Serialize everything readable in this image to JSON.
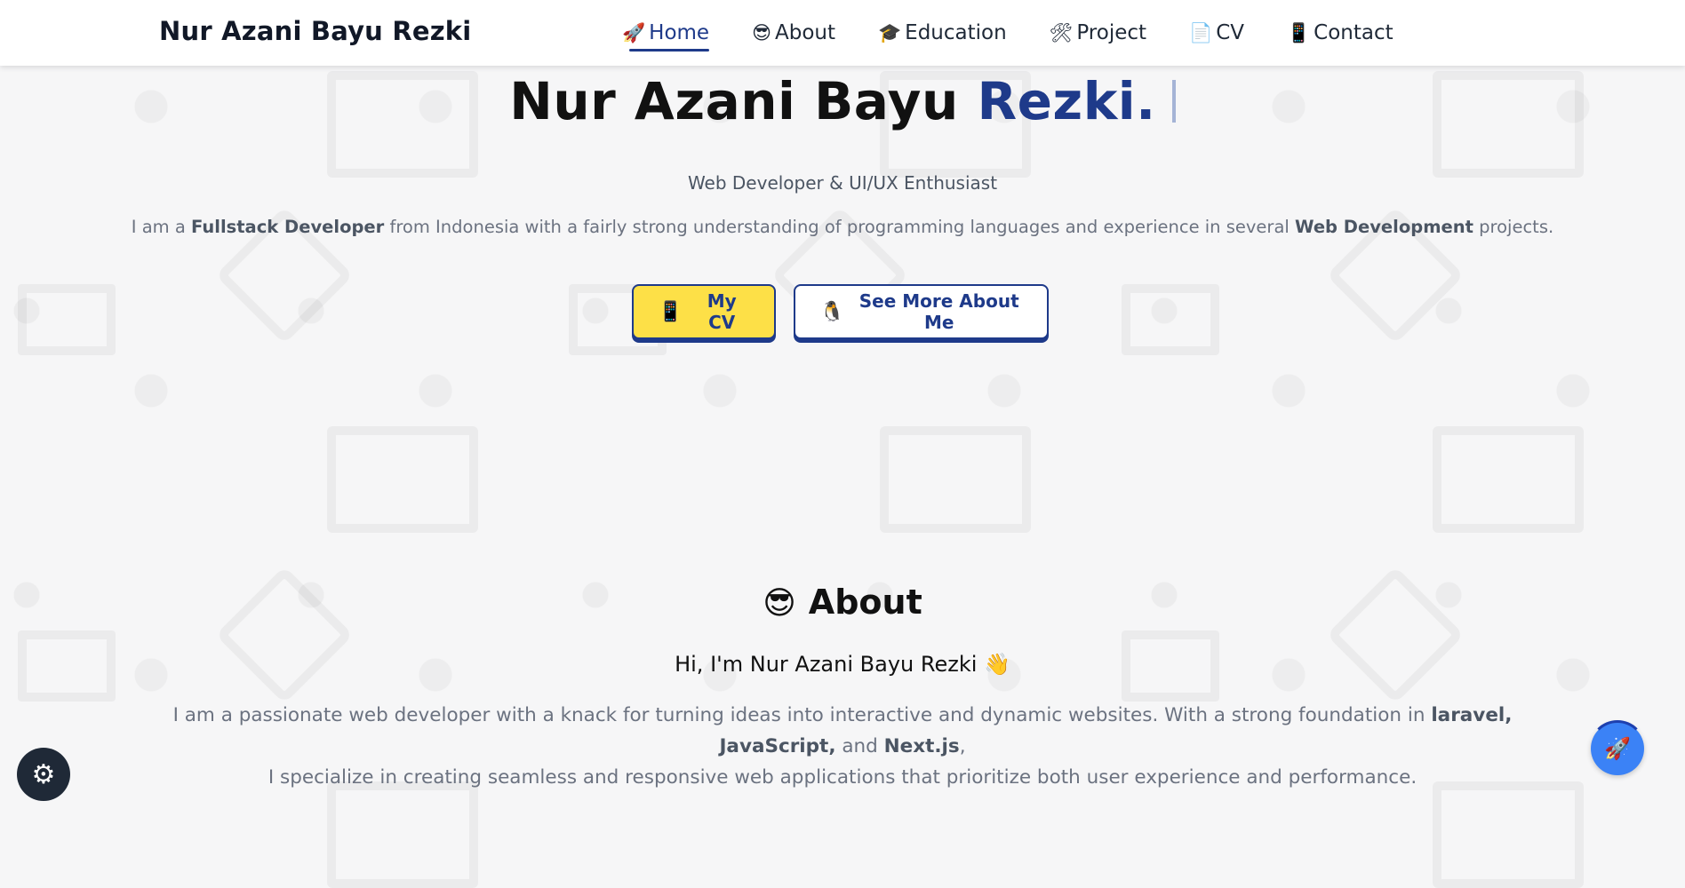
{
  "header": {
    "brand": "Nur Azani Bayu Rezki",
    "nav": [
      {
        "icon": "🚀",
        "label": "Home",
        "active": true
      },
      {
        "icon": "😎",
        "label": "About"
      },
      {
        "icon": "🎓",
        "label": "Education"
      },
      {
        "icon": "🛠",
        "label": "Project"
      },
      {
        "icon": "📄",
        "label": "CV"
      },
      {
        "icon": "📱",
        "label": "Contact"
      }
    ]
  },
  "hero": {
    "title_main": "Nur Azani Bayu ",
    "title_accent": "Rezki.",
    "subtitle": "Web Developer & UI/UX Enthusiast",
    "intro": {
      "p1": "I am a ",
      "b1": "Fullstack Developer",
      "p2": " from Indonesia with a fairly strong understanding of programming languages and experience in several ",
      "b2": "Web Development",
      "p3": " projects."
    },
    "buttons": {
      "cv_icon": "📱",
      "cv_label": "My CV",
      "more_icon": "🐧",
      "more_label": "See More About Me"
    }
  },
  "about": {
    "icon": "😎",
    "heading": "About",
    "greeting": "Hi, I'm Nur Azani Bayu Rezki 👋",
    "text": {
      "p1": "I am a passionate web developer with a knack for turning ideas into interactive and dynamic websites. With a strong foundation in ",
      "b1": "laravel, JavaScript,",
      "p2": " and ",
      "b2": "Next.js",
      "p3": ",",
      "line2": "I specialize in creating seamless and responsive web applications that prioritize both user experience and performance."
    }
  },
  "fabs": {
    "settings_icon": "⚙",
    "top_icon": "🚀"
  },
  "colors": {
    "accent": "#1e3a8a",
    "cv_button": "#fde047",
    "fab_blue": "#3b82f6",
    "settings_fab": "#1f2937"
  }
}
